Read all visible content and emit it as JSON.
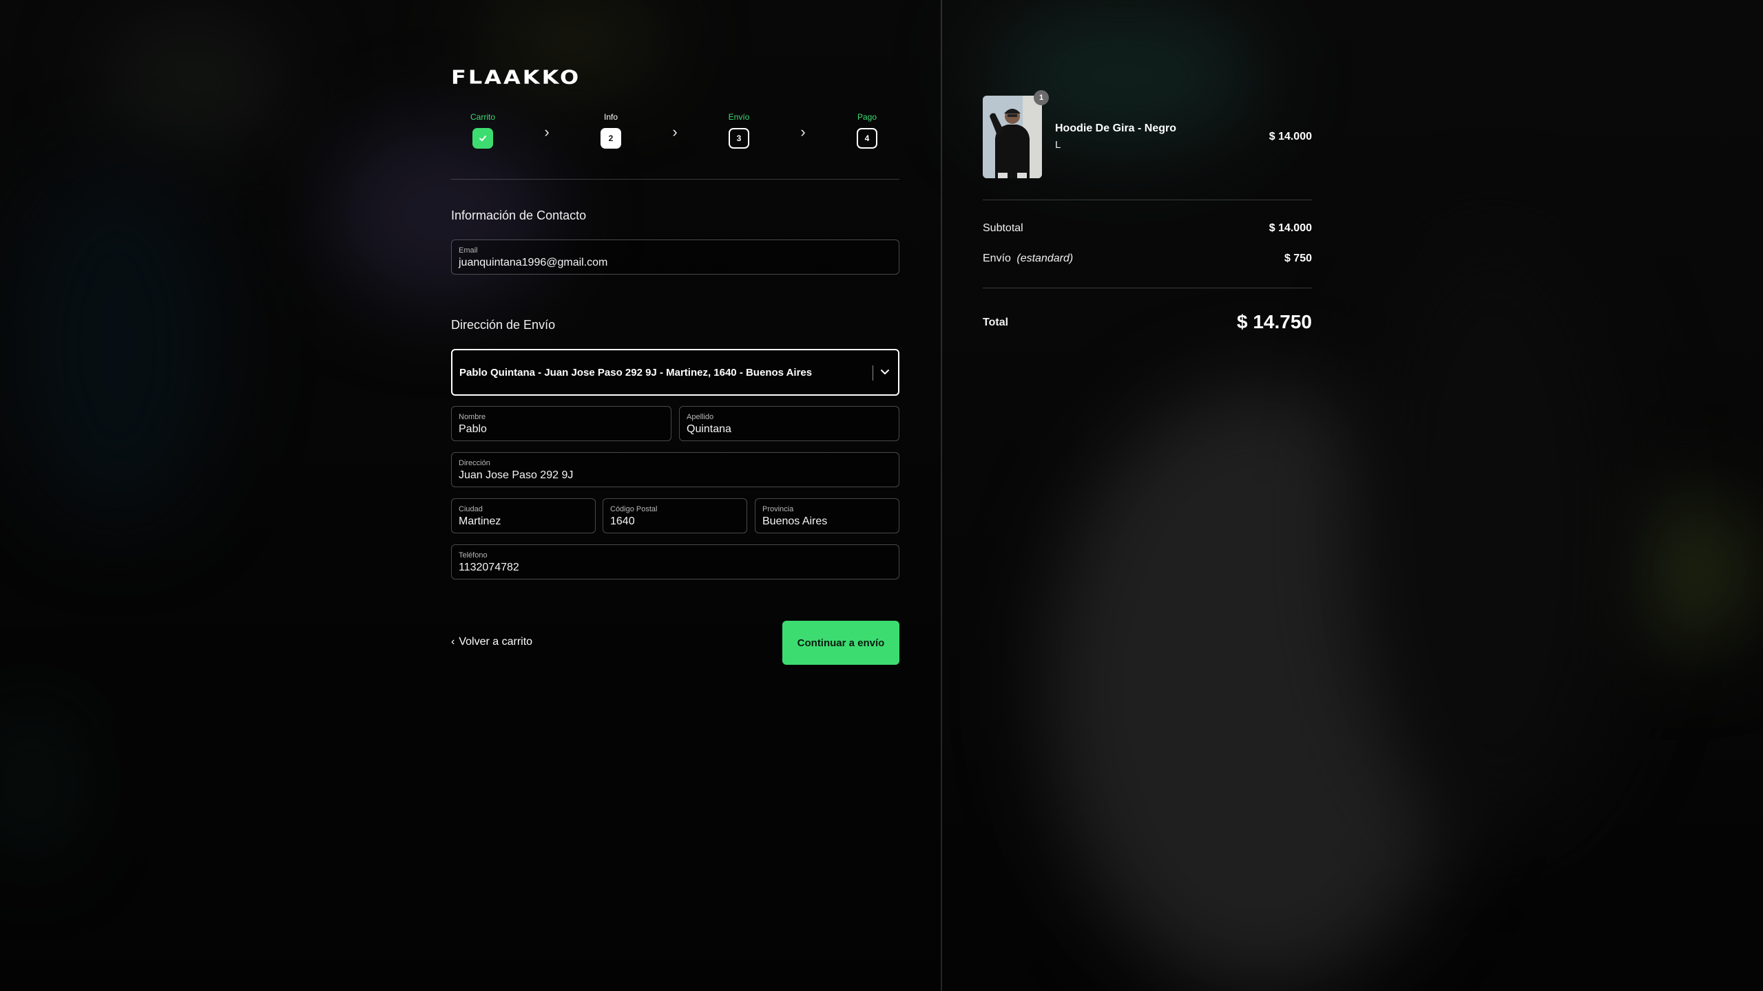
{
  "brand": {
    "logo": "FLAAKKO"
  },
  "steps": [
    {
      "label": "Carrito",
      "num": "",
      "state": "done"
    },
    {
      "label": "Info",
      "num": "2",
      "state": "active"
    },
    {
      "label": "Envío",
      "num": "3",
      "state": "upcoming"
    },
    {
      "label": "Pago",
      "num": "4",
      "state": "upcoming"
    }
  ],
  "contact": {
    "title": "Información de Contacto",
    "email_label": "Email",
    "email_value": "juanquintana1996@gmail.com"
  },
  "shipping": {
    "title": "Dirección de Envío",
    "saved_address": "Pablo Quintana - Juan Jose Paso 292 9J - Martinez, 1640 - Buenos Aires",
    "first_name_label": "Nombre",
    "first_name": "Pablo",
    "last_name_label": "Apellido",
    "last_name": "Quintana",
    "address_label": "Dirección",
    "address": "Juan Jose Paso 292 9J",
    "city_label": "Ciudad",
    "city": "Martinez",
    "zip_label": "Código Postal",
    "zip": "1640",
    "province_label": "Provincia",
    "province": "Buenos Aires",
    "phone_label": "Teléfono",
    "phone": "1132074782"
  },
  "actions": {
    "back": "Volver a carrito",
    "continue": "Continuar a envío"
  },
  "summary": {
    "item": {
      "name": "Hoodie De Gira - Negro",
      "variant": "L",
      "qty": "1",
      "price": "$ 14.000"
    },
    "subtotal_label": "Subtotal",
    "subtotal": "$ 14.000",
    "shipping_label": "Envío",
    "shipping_method": "(estandard)",
    "shipping": "$ 750",
    "total_label": "Total",
    "total": "$ 14.750"
  },
  "colors": {
    "accent": "#3ddc71",
    "step_done": "#3ddc71",
    "background": "#0a0a0a"
  }
}
